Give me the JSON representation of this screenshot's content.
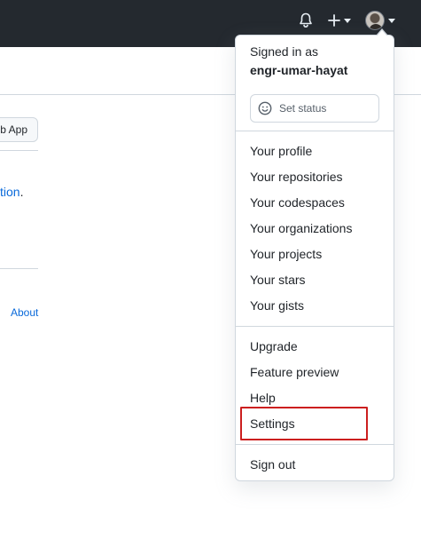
{
  "header": {
    "notifications_icon": "bell-icon",
    "create_icon": "plus-icon",
    "avatar_icon": "avatar-icon"
  },
  "page": {
    "app_button_label": "b App",
    "link_fragment": "tion",
    "link_suffix": ".",
    "footer_about": "About"
  },
  "menu": {
    "signed_in_label": "Signed in as",
    "username": "engr-umar-hayat",
    "status_label": "Set status",
    "section1": [
      "Your profile",
      "Your repositories",
      "Your codespaces",
      "Your organizations",
      "Your projects",
      "Your stars",
      "Your gists"
    ],
    "section2": [
      "Upgrade",
      "Feature preview",
      "Help",
      "Settings"
    ],
    "sign_out": "Sign out"
  },
  "colors": {
    "header_bg": "#24292f",
    "link": "#0969da",
    "highlight": "#cc1f1f"
  }
}
